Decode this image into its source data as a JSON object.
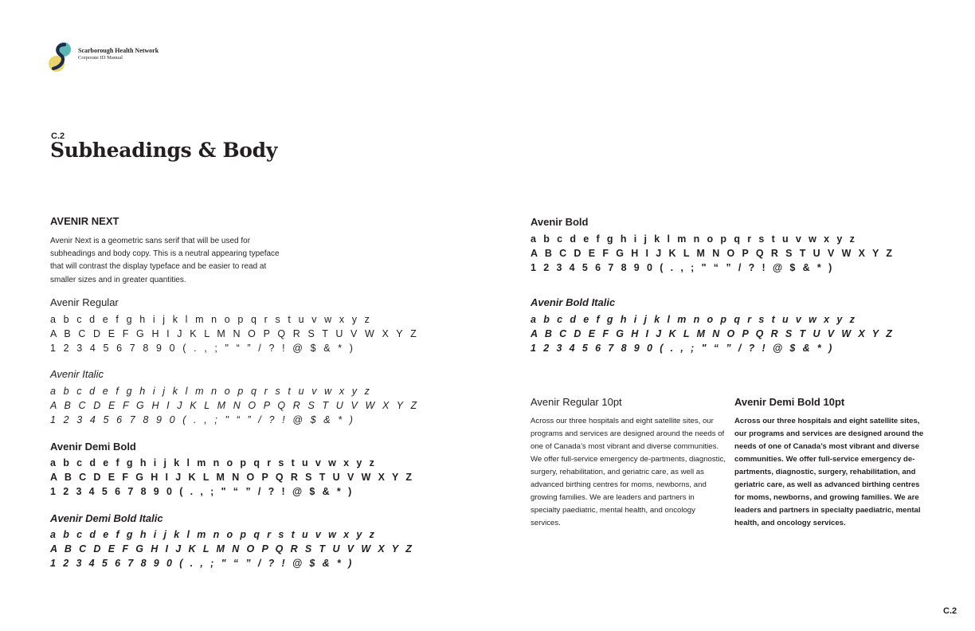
{
  "header": {
    "org_name": "Scarborough Health Network",
    "org_subtitle": "Corporate ID Manual"
  },
  "colors": {
    "logo_teal": "#5bb7b5",
    "logo_yellow": "#e9d56b",
    "logo_navy": "#1d2a4a",
    "text": "#231f20"
  },
  "section": {
    "number": "C.2",
    "title": "Subheadings & Body"
  },
  "typeface": {
    "heading": "AVENIR NEXT",
    "description": "Avenir Next is a geometric sans serif that will be used for subheadings and body copy. This is a neutral appearing typeface that will contrast the display typeface and be easier to read at smaller sizes and in greater quantities."
  },
  "specimens": [
    {
      "label": "Avenir Regular",
      "lower": "a b c d e f g h i j k l m n o p q r s t u v w x y z",
      "upper": "A B C D E F G H I J K L M N O P Q R S T U V W X Y Z",
      "numbers": "1 2 3 4 5 6 7 8 9 0 ( . , ; \" “ ” / ? ! @ $ & * )"
    },
    {
      "label": "Avenir Italic",
      "lower": "a b c d e f g h i j k l m n o p q r s t u v w x y z",
      "upper": "A B C D E F G H I J K L M N O P Q R S T U V W X Y Z",
      "numbers": "1 2 3 4 5 6 7 8 9 0 ( . , ; \" “ ” / ? ! @ $ & * )"
    },
    {
      "label": "Avenir Demi Bold",
      "lower": "a b c d e f g h i j k l m n o p q r s t u v w x y z",
      "upper": "A B C D E F G H I J K L M N O P Q R S T U V W X Y Z",
      "numbers": "1 2 3 4 5 6 7 8 9 0 ( . , ; \" “ ” / ? ! @ $ & * )"
    },
    {
      "label": "Avenir Demi Bold Italic",
      "lower": "a b c d e f g h i j k l m n o p q r s t u v w x y z",
      "upper": "A B C D E F G H I J K L M N O P Q R S T U V W X Y Z",
      "numbers": "1 2 3 4 5 6 7 8 9 0 ( . , ; \" “ ” / ? ! @ $ & * )"
    },
    {
      "label": "Avenir Bold",
      "lower": "a b c d e f g h i j k l m n o p q r s t u v w x y z",
      "upper": "A B C D E F G H I J K L M N O P Q R S T U V W X Y Z",
      "numbers": "1 2 3 4 5 6 7 8 9 0 ( . , ; \" “ ” / ? ! @ $ & * )"
    },
    {
      "label": "Avenir Bold Italic",
      "lower": "a b c d e f g h i j k l m n o p q r s t u v w x y z",
      "upper": "A B C D E F G H I J K L M N O P Q R S T U V W X Y Z",
      "numbers": "1 2 3 4 5 6 7 8 9 0 ( . , ; \" “ ” / ? ! @ $ & * )"
    }
  ],
  "samples": [
    {
      "label": "Avenir Regular 10pt",
      "text": "Across our three hospitals and eight satellite sites, our programs and services are designed around the needs of one of Canada’s most vibrant and diverse communities. We offer full-service emergency de-partments, diagnostic, surgery, rehabilitation, and geriatric care, as well as advanced birthing centres for moms, newborns, and growing families.  We are leaders and partners in specialty paediatric, mental health, and oncology services."
    },
    {
      "label": "Avenir Demi Bold 10pt",
      "text": "Across our three hospitals and eight satellite sites, our programs and services are designed around the needs of one of Canada’s most vibrant and diverse communities. We offer full-service emergency de-partments, diagnostic, surgery, rehabilitation, and geriatric care, as well as advanced birthing centres for moms, newborns, and growing families.  We are leaders and partners in specialty paediatric, mental health, and oncology services."
    }
  ],
  "footer": {
    "page_number": "C.2"
  }
}
